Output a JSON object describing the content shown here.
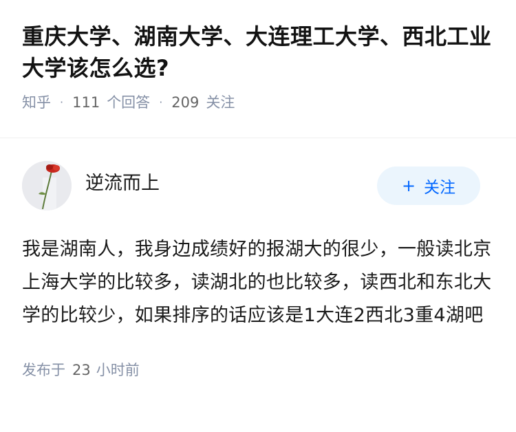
{
  "question": {
    "title": "重庆大学、湖南大学、大连理工大学、西北工业大学该怎么选?",
    "source": "知乎",
    "answer_count": "111",
    "answer_label": "个回答",
    "follower_count": "209",
    "follower_label": "关注"
  },
  "answer": {
    "author_name": "逆流而上",
    "follow_button_label": "关注",
    "follow_button_icon": "plus-icon",
    "text": "我是湖南人，我身边成绩好的报湖大的很少，一般读北京上海大学的比较多，读湖北的也比较多，读西北和东北大学的比较少，如果排序的话应该是1大连2西北3重4湖吧",
    "published_prefix": "发布于",
    "published_value": "23",
    "published_unit": "小时前"
  },
  "colors": {
    "accent": "#0066ff",
    "button_bg": "#ebf5fd",
    "meta_gray": "#8590a6"
  }
}
